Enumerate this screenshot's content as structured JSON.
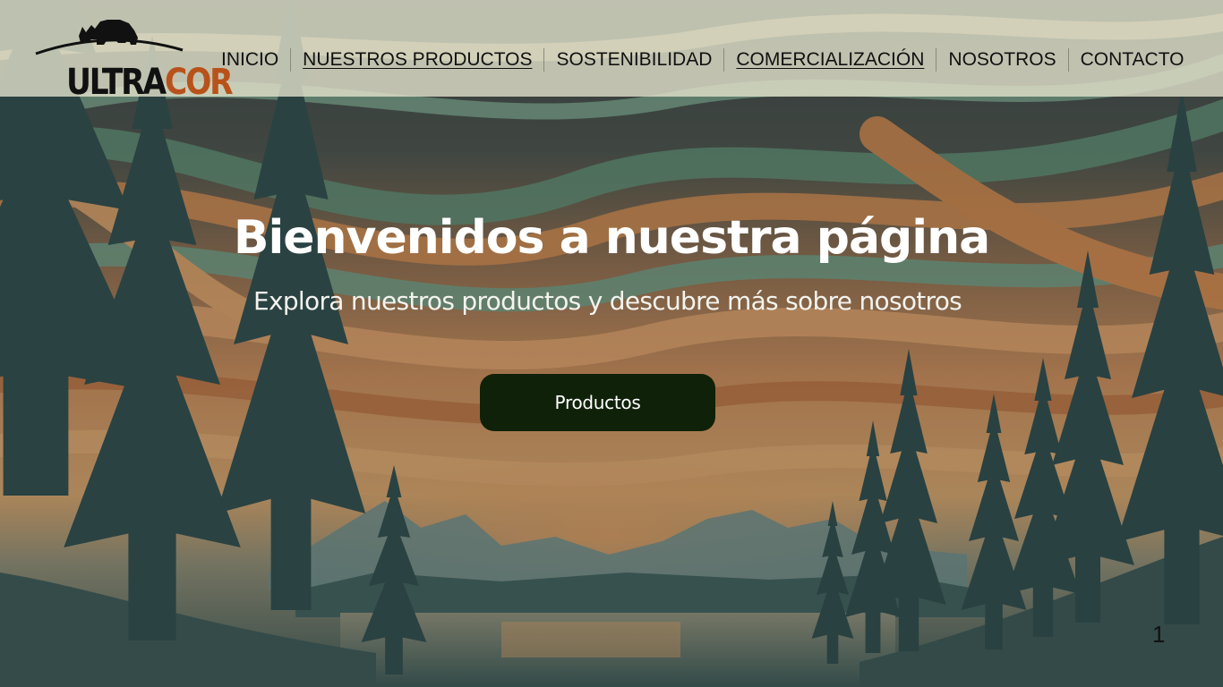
{
  "logo": {
    "part1": "ULTRA",
    "part2": "COR",
    "colors": {
      "dark": "#111111",
      "accent": "#b8521a"
    },
    "icon": "rhino-icon"
  },
  "nav": {
    "items": [
      {
        "label": "INICIO",
        "underlined": false
      },
      {
        "label": "NUESTROS PRODUCTOS",
        "underlined": true
      },
      {
        "label": "SOSTENIBILIDAD",
        "underlined": false
      },
      {
        "label": "COMERCIALIZACIÓN",
        "underlined": true
      },
      {
        "label": "NOSOTROS",
        "underlined": false
      },
      {
        "label": "CONTACTO",
        "underlined": false
      }
    ]
  },
  "hero": {
    "title": "Bienvenidos a nuestra página",
    "subtitle": "Explora nuestros productos y descubre más sobre nosotros",
    "button_label": "Productos",
    "button_color": "#0f2108",
    "background": "landscape-painting"
  },
  "page_number": "1"
}
